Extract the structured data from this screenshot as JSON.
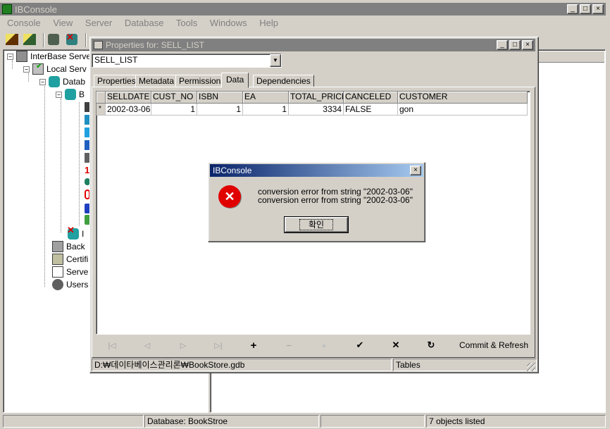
{
  "main_window": {
    "title": "IBConsole",
    "menu": [
      "Console",
      "View",
      "Server",
      "Database",
      "Tools",
      "Windows",
      "Help"
    ],
    "caption_buttons": [
      "_",
      "□",
      "×"
    ]
  },
  "tree": {
    "items": [
      {
        "label": "InterBase Serve",
        "icon": "servers-icon"
      },
      {
        "label": "Local Serv",
        "icon": "server-icon"
      },
      {
        "label": "Datab",
        "icon": "databases-icon"
      },
      {
        "label": "B",
        "icon": "database-icon"
      },
      {
        "label": "I",
        "icon": "disconnected-db-icon"
      },
      {
        "label": "Back",
        "icon": "backup-icon"
      },
      {
        "label": "Certifi",
        "icon": "certificate-icon"
      },
      {
        "label": "Serve",
        "icon": "server-log-icon"
      },
      {
        "label": "Users",
        "icon": "users-icon"
      }
    ]
  },
  "properties_window": {
    "title": "Properties for: SELL_LIST",
    "selected_table": "SELL_LIST",
    "dropdown_arrow": "▼",
    "tabs": [
      "Properties",
      "Metadata",
      "Permissions",
      "Data",
      "Dependencies"
    ],
    "active_tab": "Data",
    "grid": {
      "columns": [
        "SELLDATE",
        "CUST_NO",
        "ISBN",
        "EA",
        "TOTAL_PRICE",
        "CANCELED",
        "CUSTOMER"
      ],
      "row_marker": "*",
      "rows": [
        [
          "2002-03-06",
          "1",
          "1",
          "1",
          "3334",
          "FALSE",
          "gon"
        ]
      ]
    },
    "navigator": {
      "buttons": [
        "|◁",
        "◁",
        "▷",
        "▷|",
        "+",
        "−",
        "▲",
        "✔",
        "✕",
        "↻"
      ],
      "commit_label": "Commit & Refresh"
    },
    "status": {
      "path": "D:₩데이타베이스관리론₩BookStore.gdb",
      "type": "Tables"
    }
  },
  "dialog": {
    "title": "IBConsole",
    "close": "×",
    "messages": [
      "conversion error from string \"2002-03-06\"",
      "conversion error from string \"2002-03-06\""
    ],
    "ok_label": "확인",
    "icon": "error-icon",
    "error_icon_glyph": "✕"
  },
  "status_bar": {
    "left": "",
    "database": "Database: BookStroe",
    "middle": "",
    "objects": "7 objects listed"
  },
  "colors": {
    "active_title": "#0a246a",
    "inactive_title": "#808080",
    "error_red": "#e00000",
    "face": "#d4d0c8"
  }
}
